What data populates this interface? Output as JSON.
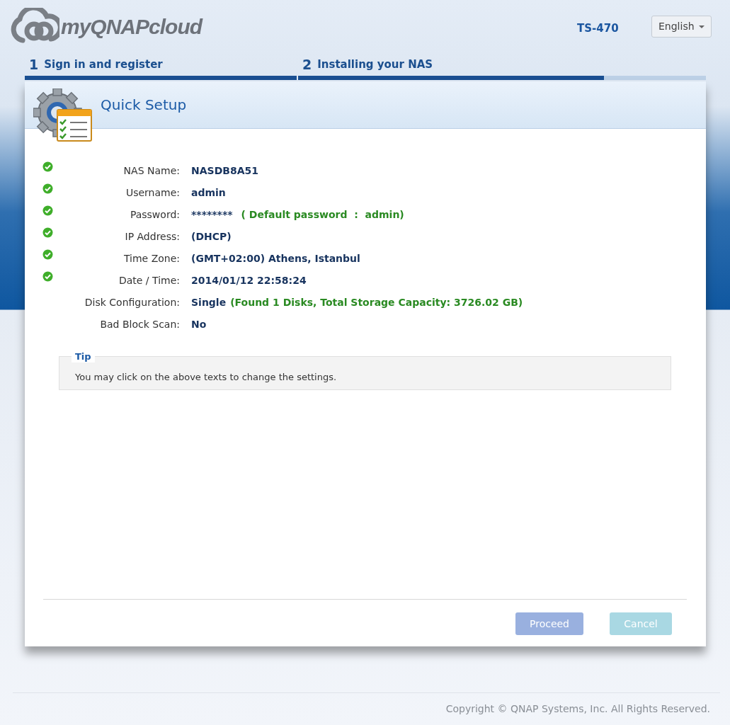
{
  "header": {
    "logo_text": "myQNAPcloud",
    "model": "TS-470",
    "language": "English"
  },
  "steps": [
    {
      "number": "1",
      "label": "Sign in and register",
      "level": 1
    },
    {
      "number": "2",
      "label": "Installing your NAS",
      "level": 0.75
    }
  ],
  "panel": {
    "title": "Quick Setup",
    "rows": [
      {
        "label": "NAS Name:",
        "value": "NASDB8A51",
        "checked": true
      },
      {
        "label": "Username:",
        "value": "admin",
        "checked": true
      },
      {
        "label": "Password:",
        "value": "********",
        "note": "( Default password  :  admin)",
        "checked": true
      },
      {
        "label": "IP Address:",
        "value": "(DHCP)",
        "checked": true
      },
      {
        "label": "Time Zone:",
        "value": "(GMT+02:00) Athens, Istanbul",
        "checked": true
      },
      {
        "label": "Date / Time:",
        "value": "2014/01/12 22:58:24",
        "checked": true
      },
      {
        "label": "Disk Configuration:",
        "value": "Single",
        "note": "(Found 1 Disks, Total Storage Capacity: 3726.02 GB)",
        "checked": false
      },
      {
        "label": "Bad Block Scan:",
        "value": "No",
        "checked": false
      }
    ],
    "tip": {
      "title": "Tip",
      "text": "You may click on the above texts to change the settings."
    },
    "buttons": [
      {
        "label": "Proceed",
        "kind": "primary",
        "disabled": true
      },
      {
        "label": "Cancel",
        "kind": "secondary",
        "disabled": true
      }
    ]
  },
  "footer": {
    "copyright": "Copyright © QNAP Systems, Inc. All Rights Reserved."
  }
}
